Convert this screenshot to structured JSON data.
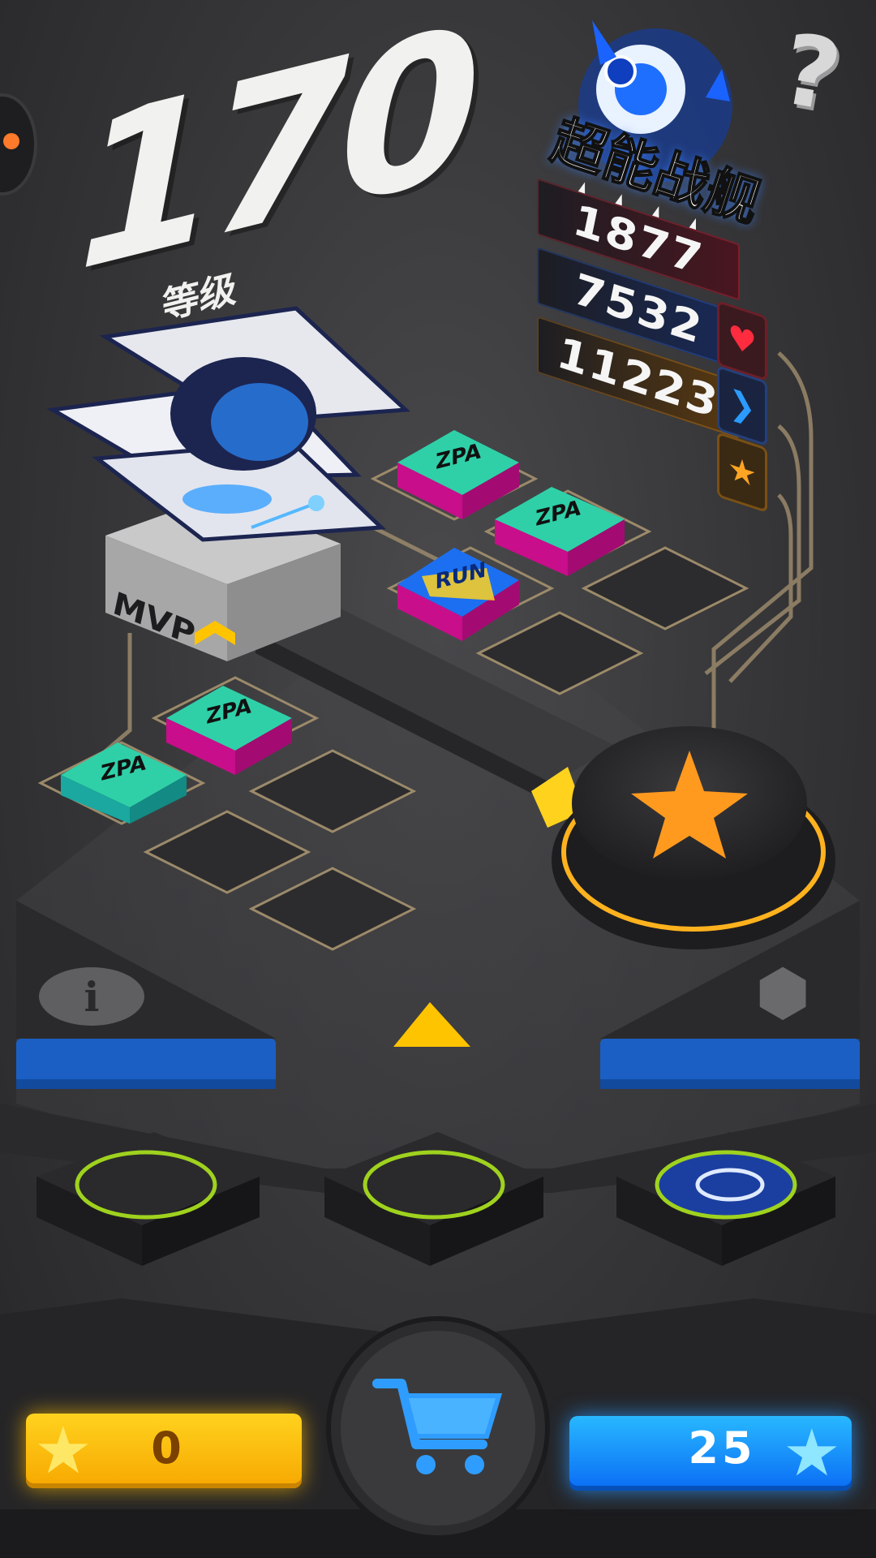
{
  "level": {
    "value": "170",
    "label": "等级"
  },
  "ship": {
    "name": "超能战舰",
    "stars": 4
  },
  "stats": {
    "hp": "1877",
    "speed": "7532",
    "power": "11223"
  },
  "tiles": {
    "badge_text": "ZPA",
    "special_text": "RUN"
  },
  "mvp_label": "MVP",
  "currency": {
    "gold": "0",
    "blue": "25"
  },
  "colors": {
    "accent_orange": "#ff9a1f",
    "gold": "#ffc400",
    "blue": "#1a8cff",
    "panel_blue": "#1b5fc4",
    "ring_green": "#9fd21e"
  }
}
